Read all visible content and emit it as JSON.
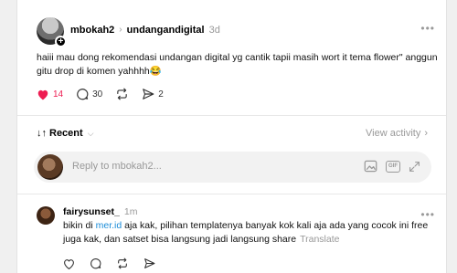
{
  "post": {
    "username": "mbokah2",
    "separator": "›",
    "community": "undangandigital",
    "time": "3d",
    "text": "haiii mau dong rekomendasi undangan digital yg cantik tapii masih wort it tema flower\" anggun gitu drop di komen yahhhh",
    "emoji": "😂",
    "likes": "14",
    "comments": "30",
    "shares": "2",
    "like_color": "#ee1d52"
  },
  "sort": {
    "label": "Recent"
  },
  "view_activity": "View activity",
  "reply": {
    "placeholder": "Reply to mbokah2..."
  },
  "comment": {
    "username": "fairysunset_",
    "time": "1m",
    "text_before": "bikin di ",
    "link": "mer.id",
    "text_after": " aja kak, pilihan templatenya banyak kok kali aja ada yang cocok ini free juga kak, dan satset bisa langsung jadi langsung share",
    "translate": "Translate"
  },
  "icons": {
    "heart": "heart-icon",
    "comment": "comment-icon",
    "repost": "repost-icon",
    "share": "share-icon",
    "more": "more-icon",
    "sort": "sort-icon",
    "image": "image-icon",
    "gif": "gif-icon",
    "expand": "expand-icon"
  },
  "colors": {
    "link": "#1a8cd8",
    "muted": "#999999",
    "like": "#ee1d52"
  }
}
